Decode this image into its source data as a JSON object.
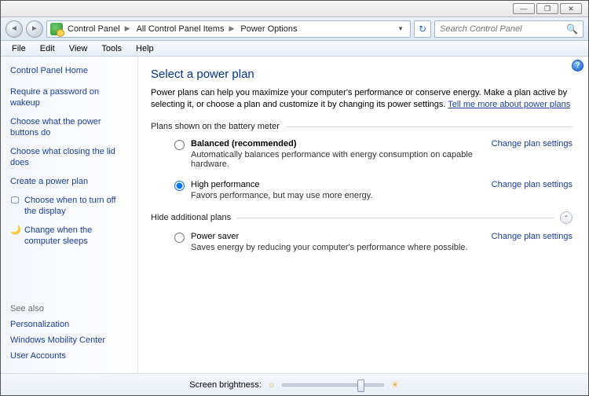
{
  "window": {
    "min": "—",
    "max": "❐",
    "close": "✕"
  },
  "breadcrumbs": {
    "a": "Control Panel",
    "b": "All Control Panel Items",
    "c": "Power Options"
  },
  "search": {
    "placeholder": "Search Control Panel"
  },
  "menu": {
    "file": "File",
    "edit": "Edit",
    "view": "View",
    "tools": "Tools",
    "help": "Help"
  },
  "sidebar": {
    "home": "Control Panel Home",
    "links": [
      "Require a password on wakeup",
      "Choose what the power buttons do",
      "Choose what closing the lid does",
      "Create a power plan",
      "Choose when to turn off the display",
      "Change when the computer sleeps"
    ],
    "seealso_label": "See also",
    "seealso": [
      "Personalization",
      "Windows Mobility Center",
      "User Accounts"
    ]
  },
  "main": {
    "title": "Select a power plan",
    "intro_a": "Power plans can help you maximize your computer's performance or conserve energy. Make a plan active by selecting it, or choose a plan and customize it by changing its power settings. ",
    "intro_link": "Tell me more about power plans",
    "group1": "Plans shown on the battery meter",
    "group2": "Hide additional plans",
    "change": "Change plan settings",
    "plans": {
      "balanced": {
        "name": "Balanced (recommended)",
        "desc": "Automatically balances performance with energy consumption on capable hardware."
      },
      "highperf": {
        "name": "High performance",
        "desc": "Favors performance, but may use more energy."
      },
      "saver": {
        "name": "Power saver",
        "desc": "Saves energy by reducing your computer's performance where possible."
      }
    }
  },
  "footer": {
    "label": "Screen brightness:"
  }
}
